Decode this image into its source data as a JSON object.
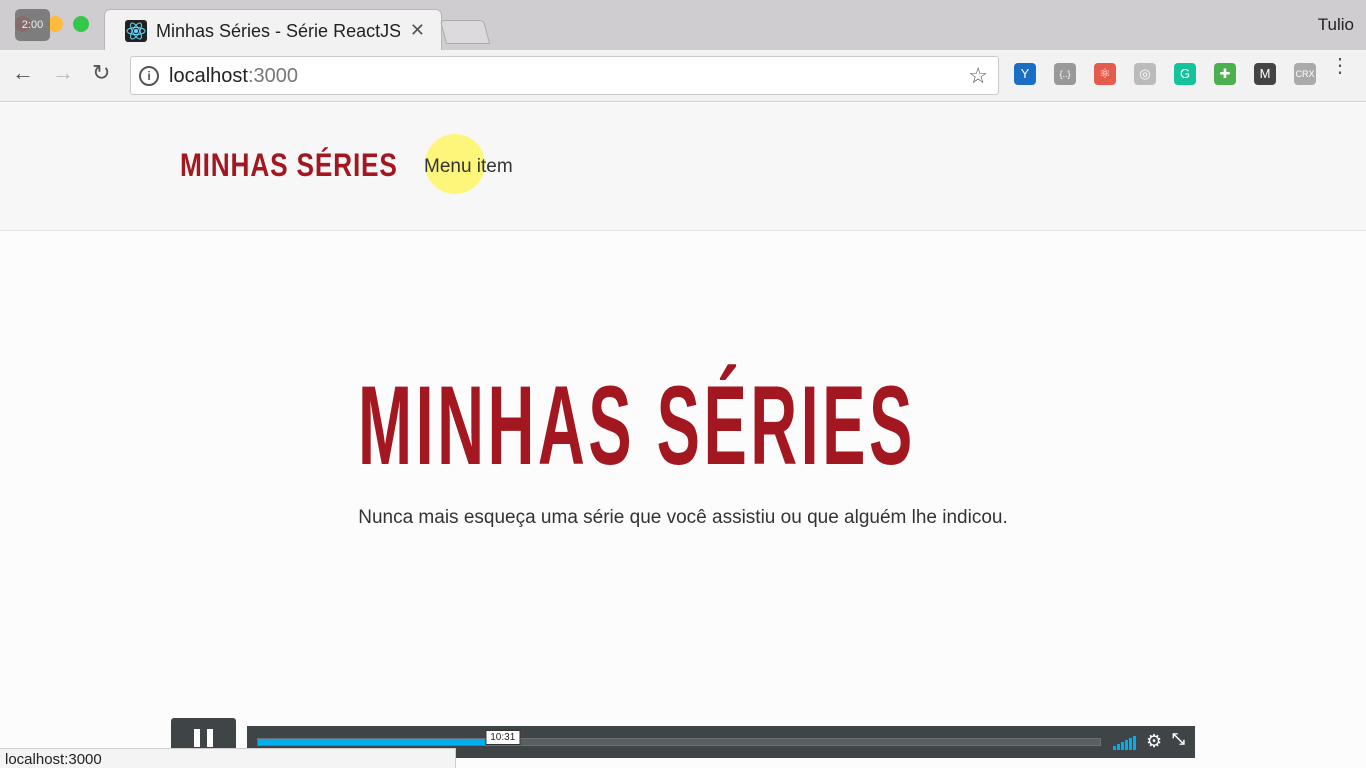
{
  "window": {
    "timer_badge": "2:00",
    "profile_name": "Tulio"
  },
  "tab": {
    "title": "Minhas Séries - Série ReactJS",
    "close_glyph": "✕",
    "favicon": "react-icon"
  },
  "toolbar": {
    "back_glyph": "←",
    "forward_glyph": "→",
    "reload_glyph": "↻",
    "url_host": "localhost",
    "url_port": ":3000",
    "star_glyph": "☆",
    "extensions": [
      {
        "name": "vue-devtools-icon",
        "label": "Y",
        "color": "#1a6fc4"
      },
      {
        "name": "json-viewer-icon",
        "label": "{..}",
        "color": "#999999"
      },
      {
        "name": "react-devtools-icon",
        "label": "⚛",
        "color": "#e55b4d"
      },
      {
        "name": "redux-devtools-icon",
        "label": "◎",
        "color": "#bbbbbb"
      },
      {
        "name": "grammarly-icon",
        "label": "G",
        "color": "#15c39a"
      },
      {
        "name": "add-extension-icon",
        "label": "✚",
        "color": "#4caf50"
      },
      {
        "name": "mailtrack-icon",
        "label": "M",
        "color": "#444444"
      },
      {
        "name": "crx-icon",
        "label": "CRX",
        "color": "#aaaaaa"
      }
    ],
    "menu_glyph": "⋮"
  },
  "navbar": {
    "brand": "MINHAS SÉRIES",
    "menu_item": "Menu item"
  },
  "hero": {
    "logo_text": "MINHAS SÉRIES",
    "tagline": "Nunca mais esqueça uma série que você assistiu ou que alguém lhe indicou."
  },
  "video": {
    "current_time": "10:31",
    "progress_fraction": 0.29,
    "buffered_fraction": 0.3,
    "gear_glyph": "⚙",
    "fullscreen_glyph": "⤡"
  },
  "status_bar": {
    "text": "localhost:3000"
  },
  "colors": {
    "brand_red": "#a31820",
    "progress_blue": "#00adef"
  }
}
